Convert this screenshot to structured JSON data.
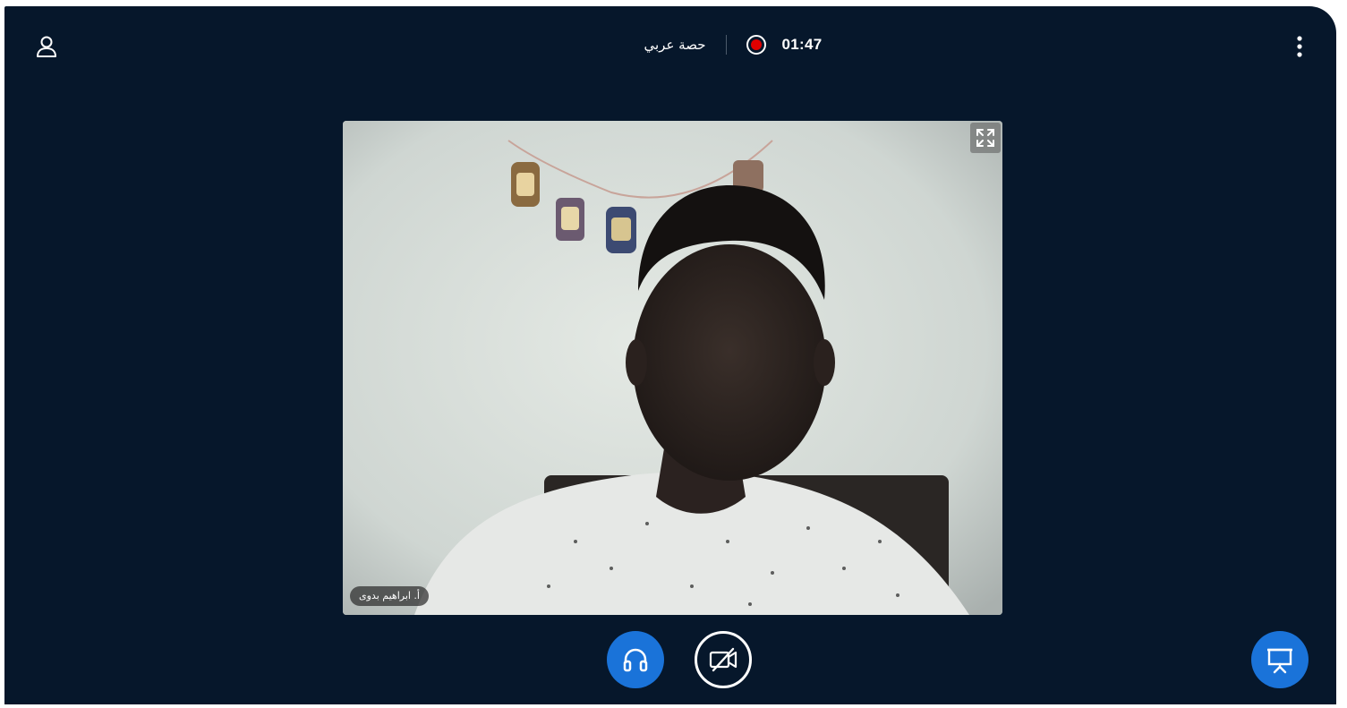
{
  "header": {
    "meeting_title": "حصة عربي",
    "recording_timer": "01:47",
    "user_icon": "user-icon",
    "more_icon": "more-vertical-icon",
    "recording_icon": "record-dot-icon"
  },
  "video": {
    "participant_name": "أ. ابراهيم بدوى",
    "fullscreen_icon": "fullscreen-icon"
  },
  "controls": {
    "audio_icon": "headphones-icon",
    "camera_icon": "camera-off-icon",
    "present_icon": "presentation-icon"
  },
  "colors": {
    "background": "#06172b",
    "accent": "#1a73d9",
    "recording": "#e10000"
  }
}
